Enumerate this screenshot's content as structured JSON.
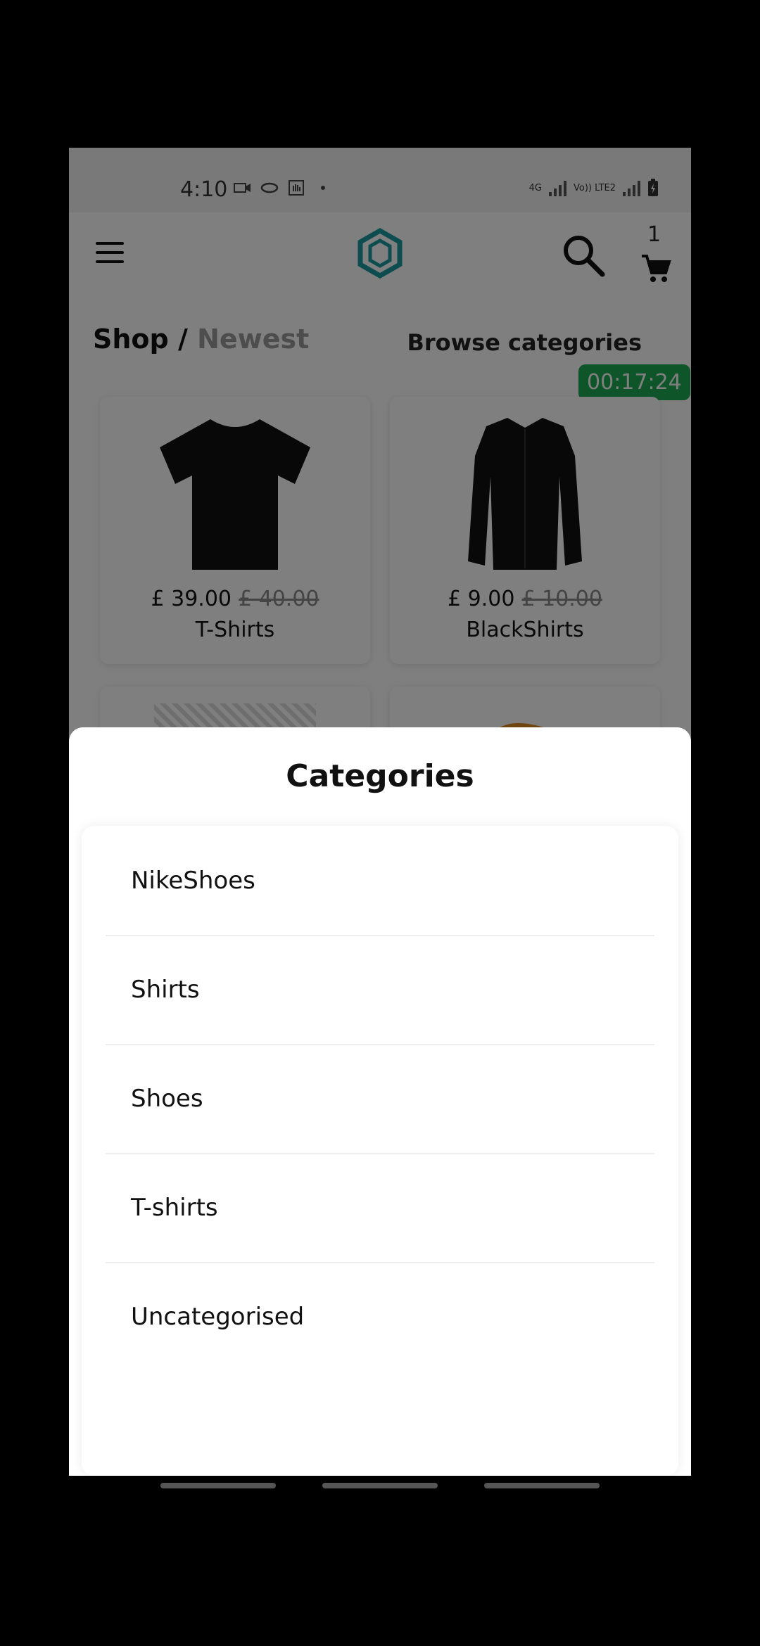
{
  "status_bar": {
    "time": "4:10",
    "network_1": "4G",
    "network_2": "Vo)) LTE2"
  },
  "app_bar": {
    "cart_count": "1"
  },
  "breadcrumb": {
    "root": "Shop",
    "separator": "/",
    "current": "Newest"
  },
  "browse_label": "Browse categories",
  "timer": "00:17:24",
  "products": [
    {
      "price": "£ 39.00",
      "old_price": "£ 40.00",
      "name": "T-Shirts"
    },
    {
      "price": "£ 9.00",
      "old_price": "£ 10.00",
      "name": "BlackShirts"
    }
  ],
  "sheet": {
    "title": "Categories",
    "items": [
      "NikeShoes",
      "Shirts",
      "Shoes",
      "T-shirts",
      "Uncategorised"
    ]
  },
  "colors": {
    "accent": "#1a9aa0",
    "timer_bg": "#1faa55"
  }
}
